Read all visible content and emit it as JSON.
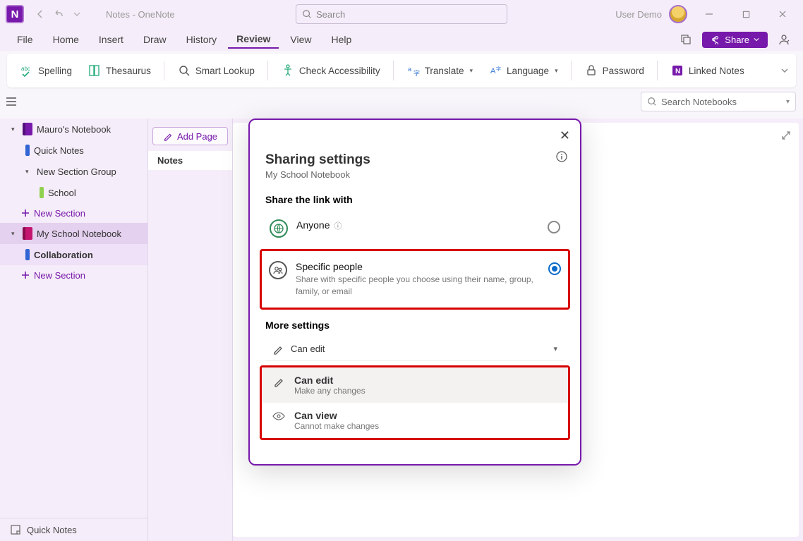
{
  "titlebar": {
    "doc_title": "Notes  -  OneNote",
    "search_placeholder": "Search",
    "user_label": "User Demo"
  },
  "tabs": {
    "file": "File",
    "home": "Home",
    "insert": "Insert",
    "draw": "Draw",
    "history": "History",
    "review": "Review",
    "view": "View",
    "help": "Help",
    "share": "Share"
  },
  "ribbon": {
    "spelling": "Spelling",
    "thesaurus": "Thesaurus",
    "smart_lookup": "Smart Lookup",
    "accessibility": "Check Accessibility",
    "translate": "Translate",
    "language": "Language",
    "password": "Password",
    "linked_notes": "Linked Notes"
  },
  "search_notebooks_placeholder": "Search Notebooks",
  "sidebar": {
    "notebook1": "Mauro's Notebook",
    "quick_notes": "Quick Notes",
    "section_group": "New Section Group",
    "school_section": "School",
    "new_section1": "New Section",
    "notebook2": "My  School Notebook",
    "collaboration": "Collaboration",
    "new_section2": "New Section",
    "footer_quick_notes": "Quick Notes"
  },
  "pages": {
    "add_page": "Add Page",
    "page1": "Notes"
  },
  "dialog": {
    "title": "Sharing settings",
    "subtitle": "My School Notebook",
    "share_link_label": "Share the link with",
    "anyone": "Anyone",
    "specific_title": "Specific people",
    "specific_desc": "Share with specific people you choose using their name, group, family, or email",
    "more_settings_label": "More settings",
    "can_edit_sel": "Can edit",
    "can_edit_title": "Can edit",
    "can_edit_desc": "Make any changes",
    "can_view_title": "Can view",
    "can_view_desc": "Cannot make changes"
  }
}
